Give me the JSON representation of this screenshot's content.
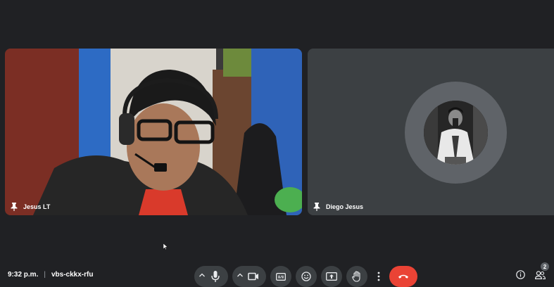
{
  "participants": [
    {
      "name": "Jesus LT"
    },
    {
      "name": "Diego Jesus"
    }
  ],
  "meeting": {
    "time": "9:32 p.m.",
    "code": "vbs-ckkx-rfu"
  },
  "people_count": "2",
  "icons": {
    "pin": "pin-icon",
    "mic": "microphone-icon",
    "camera": "camera-icon",
    "captions": "captions-icon",
    "emoji": "emoji-icon",
    "present": "present-screen-icon",
    "hand": "raise-hand-icon",
    "more": "more-options-icon",
    "hangup": "hang-up-icon",
    "info": "info-icon",
    "people": "people-icon"
  },
  "colors": {
    "background": "#202124",
    "control": "#3c4043",
    "hangup": "#ea4335"
  }
}
